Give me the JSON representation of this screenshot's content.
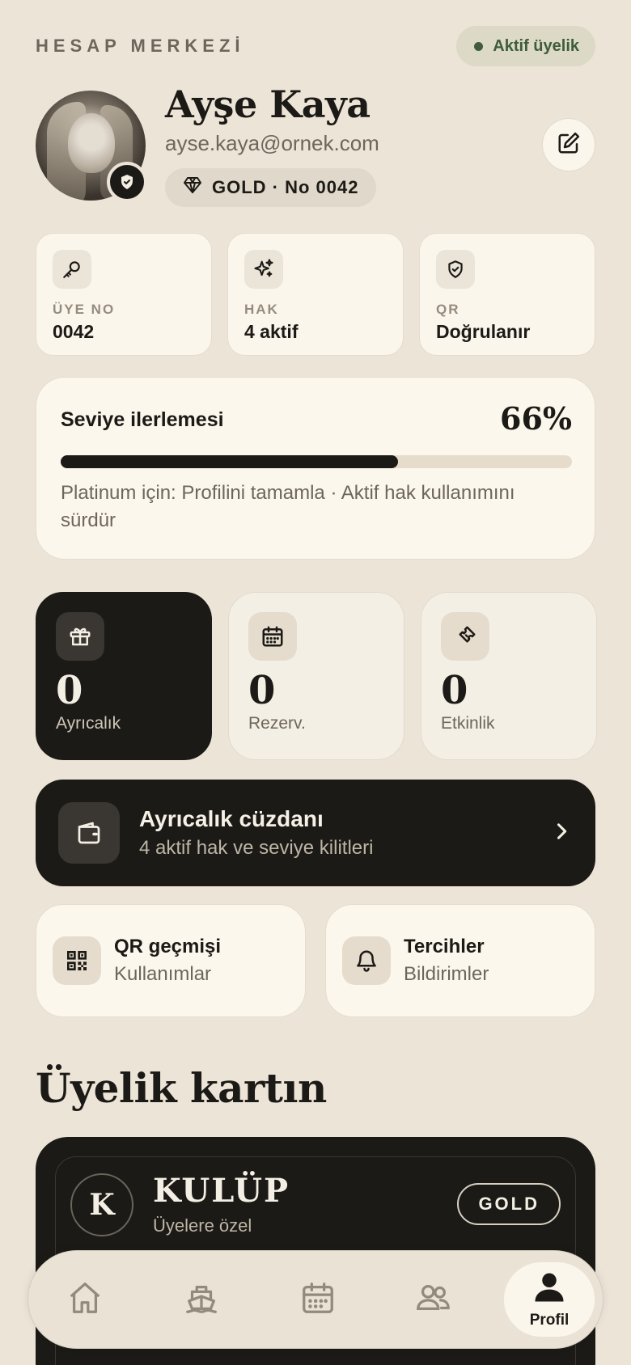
{
  "header": {
    "label": "HESAP MERKEZİ",
    "status": "Aktif üyelik"
  },
  "profile": {
    "name": "Ayşe Kaya",
    "email": "ayse.kaya@ornek.com",
    "tier": "GOLD · No 0042"
  },
  "info_cards": [
    {
      "key": "ÜYE NO",
      "value": "0042",
      "icon": "key-icon"
    },
    {
      "key": "HAK",
      "value": "4 aktif",
      "icon": "sparkles-icon"
    },
    {
      "key": "QR",
      "value": "Doğrulanır",
      "icon": "shield-check-icon"
    }
  ],
  "progress": {
    "title": "Seviye ilerlemesi",
    "percent_label": "66%",
    "percent": 66,
    "hint": "Platinum için: Profilini tamamla · Aktif hak kullanımını sürdür"
  },
  "stats": [
    {
      "value": "0",
      "label": "Ayrıcalık",
      "icon": "gift-icon"
    },
    {
      "value": "0",
      "label": "Rezerv.",
      "icon": "calendar-icon"
    },
    {
      "value": "0",
      "label": "Etkinlik",
      "icon": "ticket-icon"
    }
  ],
  "wallet": {
    "title": "Ayrıcalık cüzdanı",
    "subtitle": "4 aktif hak ve seviye kilitleri"
  },
  "shortcuts": [
    {
      "title": "QR geçmişi",
      "subtitle": "Kullanımlar",
      "icon": "qr-code-icon"
    },
    {
      "title": "Tercihler",
      "subtitle": "Bildirimler",
      "icon": "bell-icon"
    }
  ],
  "membership": {
    "section_title": "Üyelik kartın",
    "logo_letter": "K",
    "club_name": "KULÜP",
    "club_subtitle": "Üyelere özel",
    "tier": "GOLD"
  },
  "nav": {
    "items": [
      "home-icon",
      "ship-icon",
      "calendar-icon",
      "users-icon"
    ],
    "active_label": "Profil"
  },
  "colors": {
    "background": "#ece4d7",
    "dark": "#1c1a16",
    "accent_green": "#3f5d3a",
    "card": "#faf6ec"
  }
}
